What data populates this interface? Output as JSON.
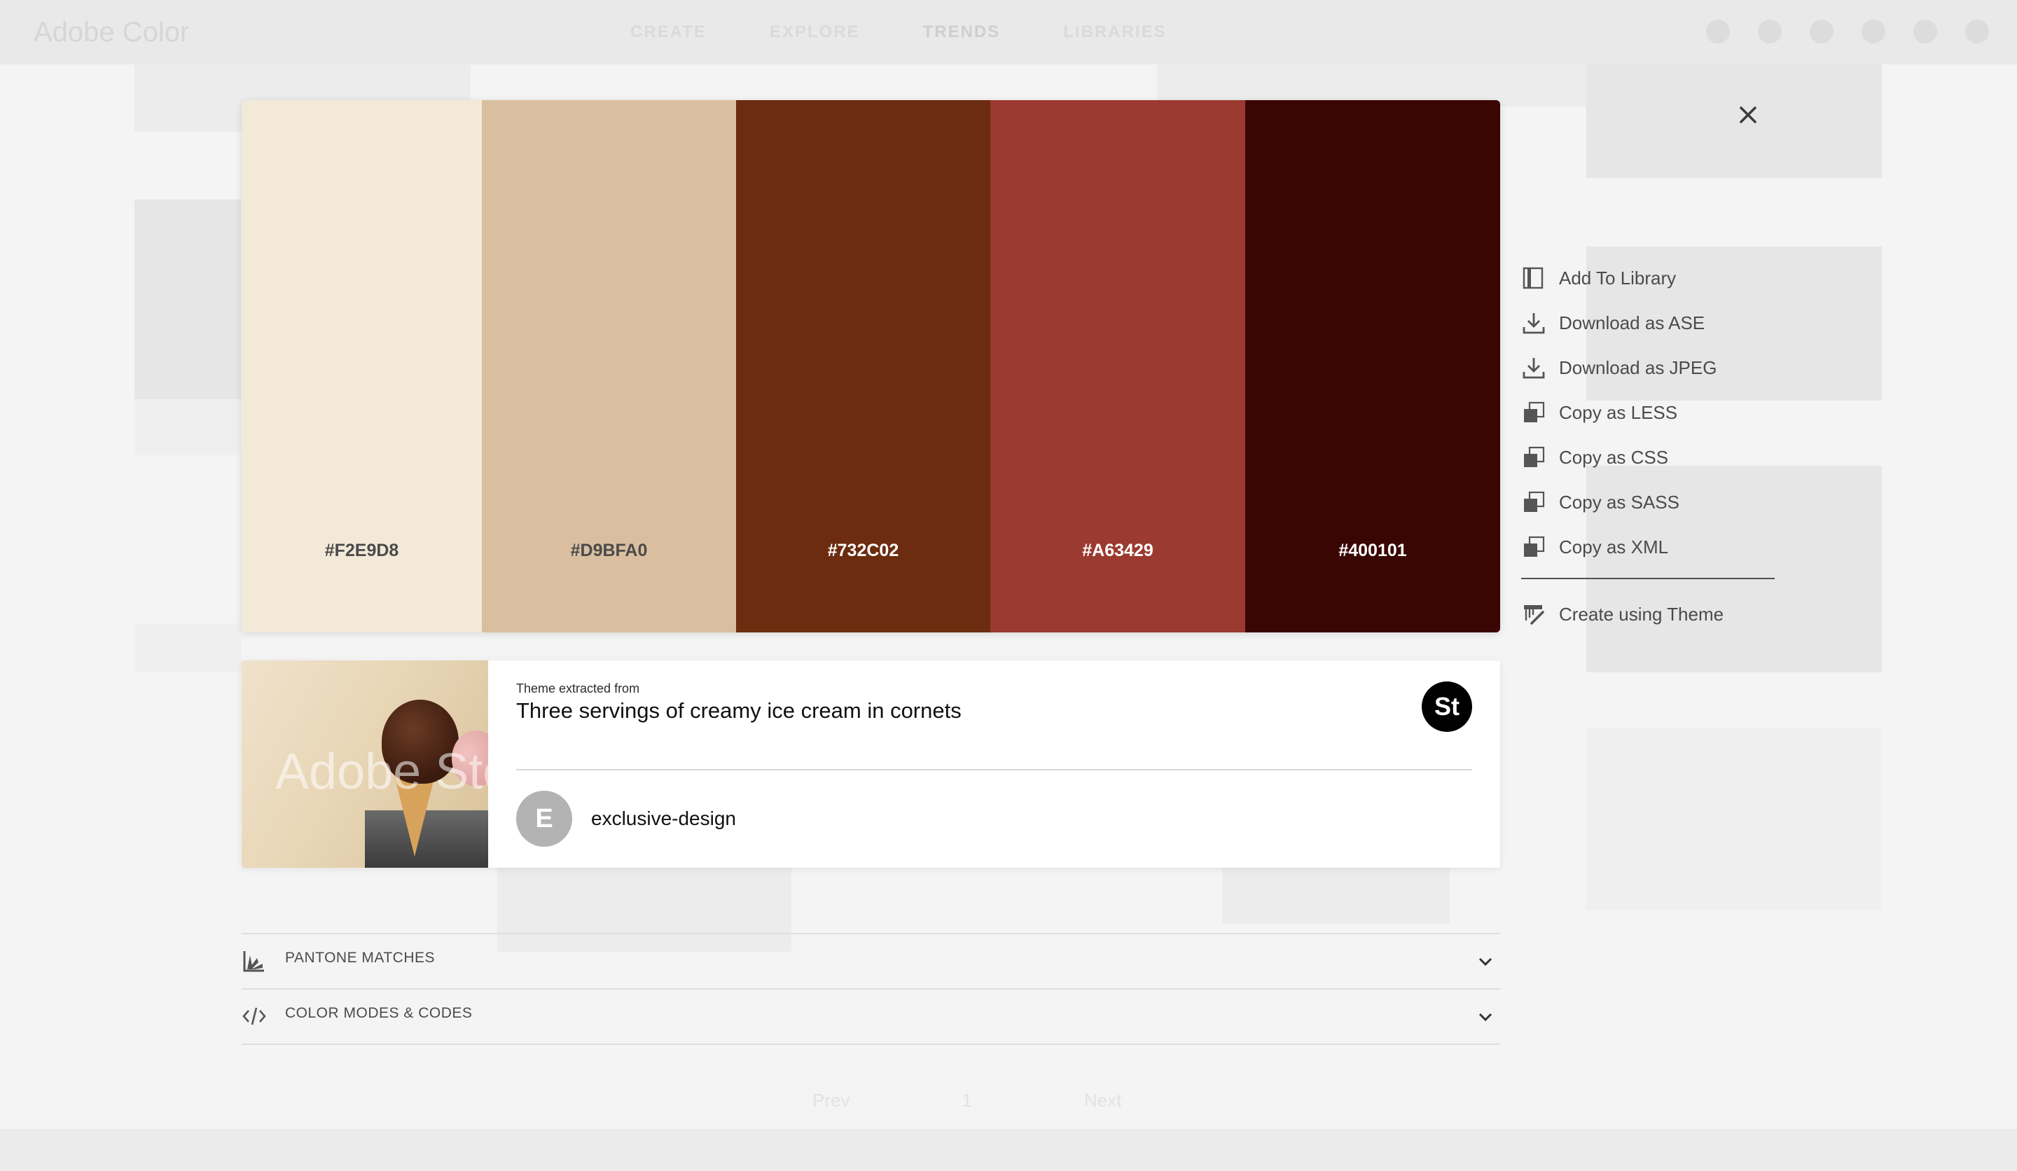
{
  "background": {
    "app_name": "Adobe Color",
    "nav": [
      "CREATE",
      "EXPLORE",
      "TRENDS",
      "LIBRARIES"
    ],
    "active_nav": "TRENDS",
    "pager": {
      "prev": "Prev",
      "page": "1",
      "next": "Next"
    }
  },
  "palette": {
    "swatches": [
      {
        "hex": "#F2E9D8",
        "color": "#F2E9D8",
        "text_color": "#4a4a4a"
      },
      {
        "hex": "#D9BFA0",
        "color": "#D9BFA0",
        "text_color": "#4a4a4a"
      },
      {
        "hex": "#732C02",
        "color": "#6B2C0F",
        "text_color": "#ffffff"
      },
      {
        "hex": "#A63429",
        "color": "#9B3A30",
        "text_color": "#ffffff"
      },
      {
        "hex": "#400101",
        "color": "#3A0604",
        "text_color": "#ffffff"
      }
    ]
  },
  "actions": [
    {
      "label": "Add To Library",
      "icon": "library-icon"
    },
    {
      "label": "Download as ASE",
      "icon": "download-icon"
    },
    {
      "label": "Download as JPEG",
      "icon": "download-icon"
    },
    {
      "label": "Copy as LESS",
      "icon": "copy-icon"
    },
    {
      "label": "Copy as CSS",
      "icon": "copy-icon"
    },
    {
      "label": "Copy as SASS",
      "icon": "copy-icon"
    },
    {
      "label": "Copy as XML",
      "icon": "copy-icon"
    }
  ],
  "create_action": {
    "label": "Create using Theme",
    "icon": "brush-icon"
  },
  "theme_info": {
    "extracted_label": "Theme extracted from",
    "title": "Three servings of creamy ice cream in cornets",
    "source_badge": "St",
    "thumbnail_watermark": "Adobe Stock",
    "author_initial": "E",
    "author": "exclusive-design"
  },
  "accordions": [
    {
      "label": "PANTONE MATCHES",
      "icon": "pantone-fan-icon"
    },
    {
      "label": "COLOR MODES & CODES",
      "icon": "code-icon"
    }
  ],
  "colors": {
    "accent_text": "#4b4b4b",
    "card_bg": "#ffffff",
    "page_bg": "#f4f4f4"
  }
}
